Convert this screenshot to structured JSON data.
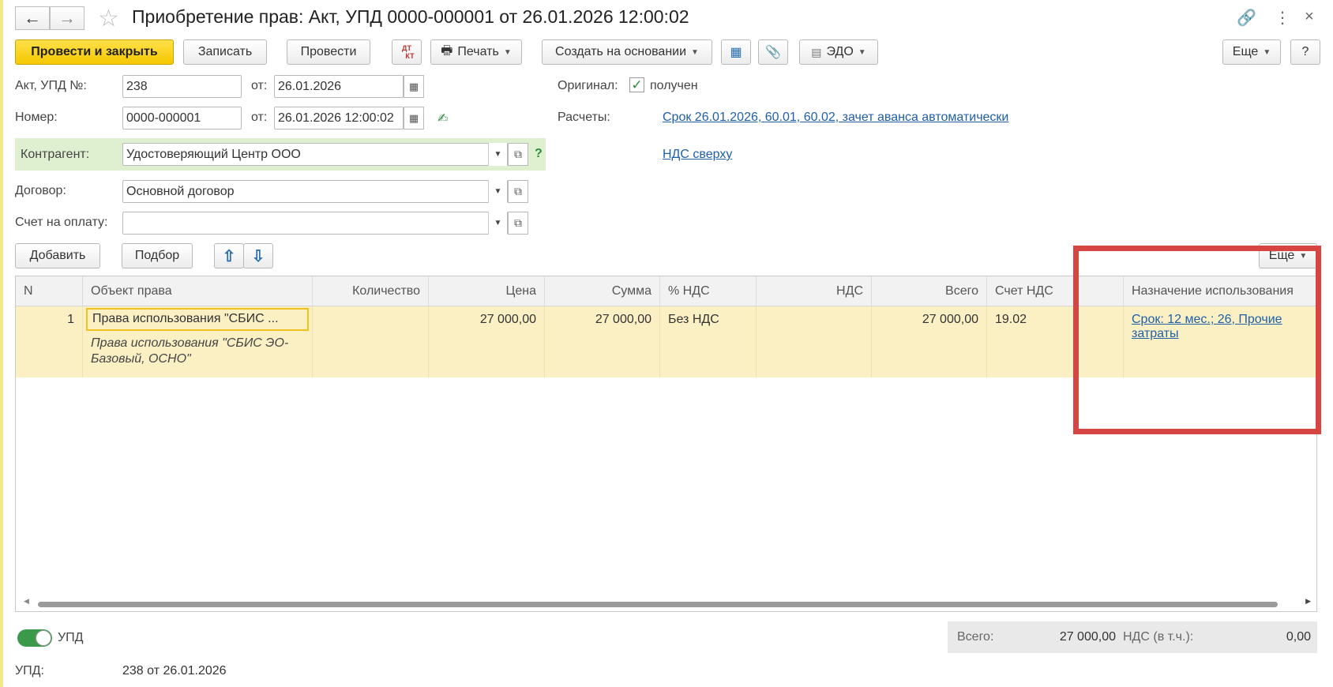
{
  "window": {
    "title": "Приобретение прав: Акт, УПД 0000-000001 от 26.01.2026 12:00:02",
    "back_icon": "arrow-left",
    "forward_icon": "arrow-right",
    "favorite_icon": "star",
    "link_icon": "link",
    "menu_icon": "more-vertical",
    "close_icon": "close"
  },
  "toolbar": {
    "post_close": "Провести и закрыть",
    "write": "Записать",
    "post": "Провести",
    "dtkt_top": "ДТ",
    "dtkt_bottom": "КТ",
    "print": "Печать",
    "create_based": "Создать на основании",
    "edo": "ЭДО",
    "more": "Еще",
    "help": "?"
  },
  "form": {
    "act_label": "Акт, УПД №:",
    "act_value": "238",
    "from_label1": "от:",
    "act_date": "26.01.2026",
    "number_label": "Номер:",
    "number_value": "0000-000001",
    "from_label2": "от:",
    "number_date": "26.01.2026 12:00:02",
    "original_label": "Оригинал:",
    "original_checked": true,
    "original_text": "получен",
    "settlements_label": "Расчеты:",
    "settlements_link": "Срок 26.01.2026, 60.01, 60.02, зачет аванса автоматически",
    "vat_link": "НДС сверху",
    "counterparty_label": "Контрагент:",
    "counterparty_value": "Удостоверяющий Центр ООО",
    "counterparty_help": "?",
    "contract_label": "Договор:",
    "contract_value": "Основной договор",
    "invoice_label": "Счет на оплату:",
    "invoice_value": ""
  },
  "table_toolbar": {
    "add": "Добавить",
    "pick": "Подбор",
    "more": "Еще"
  },
  "table": {
    "headers": [
      "N",
      "Объект права",
      "Количество",
      "Цена",
      "Сумма",
      "% НДС",
      "НДС",
      "Всего",
      "Счет НДС",
      "Назначение использования"
    ],
    "rows": [
      {
        "n": "1",
        "object": "Права использования \"СБИС ...",
        "object_desc": "Права использования \"СБИС ЭО-Базовый, ОСНО\"",
        "quantity": "",
        "price": "27 000,00",
        "sum": "27 000,00",
        "vat_rate": "Без НДС",
        "vat": "",
        "total": "27 000,00",
        "vat_account": "19.02",
        "purpose": "Срок: 12 мес.; 26, Прочие затраты"
      }
    ]
  },
  "footer": {
    "upd_toggle_label": "УПД",
    "upd_toggle_on": true,
    "total_label": "Всего:",
    "total_value": "27 000,00",
    "vat_incl_label": "НДС (в т.ч.):",
    "vat_incl_value": "0,00",
    "upd_label": "УПД:",
    "upd_value": "238 от 26.01.2026"
  },
  "colors": {
    "primary_button": "#f5c800",
    "highlight_row": "#fbf0c4",
    "counterparty_band": "#dff0d0",
    "link": "#1f5fa8",
    "annotation_box": "#d64541",
    "toggle_on": "#3a9a4a"
  }
}
